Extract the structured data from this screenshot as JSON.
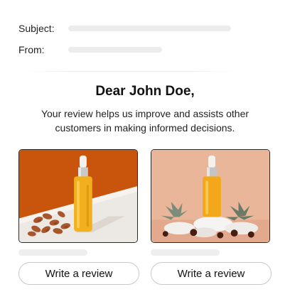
{
  "email_header": {
    "subject_label": "Subject:",
    "from_label": "From:"
  },
  "greeting": "Dear John Doe,",
  "message": "Your review helps us improve and assists other customers in making informed decisions.",
  "products": [
    {
      "button_label": "Write a review",
      "image": "serum-bottle-with-almonds"
    },
    {
      "button_label": "Write a review",
      "image": "serum-bottle-with-succulents-and-stones"
    }
  ],
  "colors": {
    "placeholder": "#ececec",
    "card1_background": "#c9540c",
    "card2_background": "#e9b69a",
    "serum": "#f2b01e"
  }
}
